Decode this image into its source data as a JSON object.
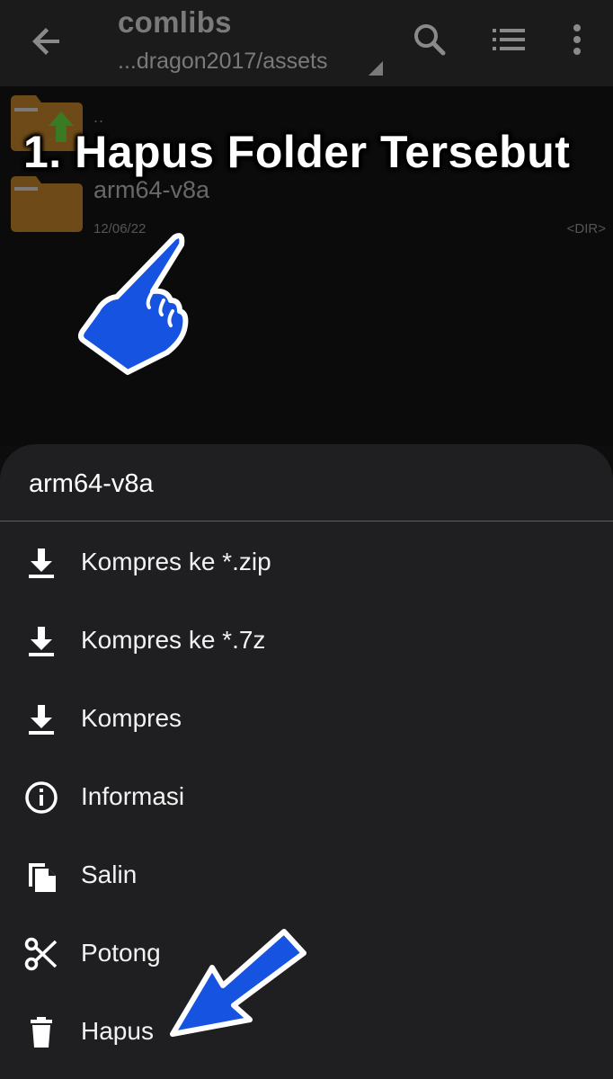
{
  "toolbar": {
    "title": "comlibs",
    "path": "...dragon2017/assets",
    "icons": [
      "back-arrow-icon",
      "search-icon",
      "list-view-icon",
      "more-vertical-icon"
    ]
  },
  "file_list": {
    "parent_label": "..",
    "items": [
      {
        "name": "arm64-v8a",
        "date": "12/06/22",
        "type": "<DIR>"
      }
    ]
  },
  "overlay": {
    "instruction": "1. Hapus Folder Tersebut"
  },
  "sheet": {
    "title": "arm64-v8a",
    "items": [
      {
        "label": "Kompres ke *.zip",
        "icon": "download-icon"
      },
      {
        "label": "Kompres ke *.7z",
        "icon": "download-icon"
      },
      {
        "label": "Kompres",
        "icon": "download-icon"
      },
      {
        "label": "Informasi",
        "icon": "info-icon"
      },
      {
        "label": "Salin",
        "icon": "copy-icon"
      },
      {
        "label": "Potong",
        "icon": "scissors-icon"
      },
      {
        "label": "Hapus",
        "icon": "trash-icon"
      }
    ]
  },
  "colors": {
    "background": "#0d0d0d",
    "toolbar": "#1b1b1b",
    "sheet": "#1f1f21",
    "folder": "#8a5a1c",
    "pointer_blue": "#1653e0"
  }
}
